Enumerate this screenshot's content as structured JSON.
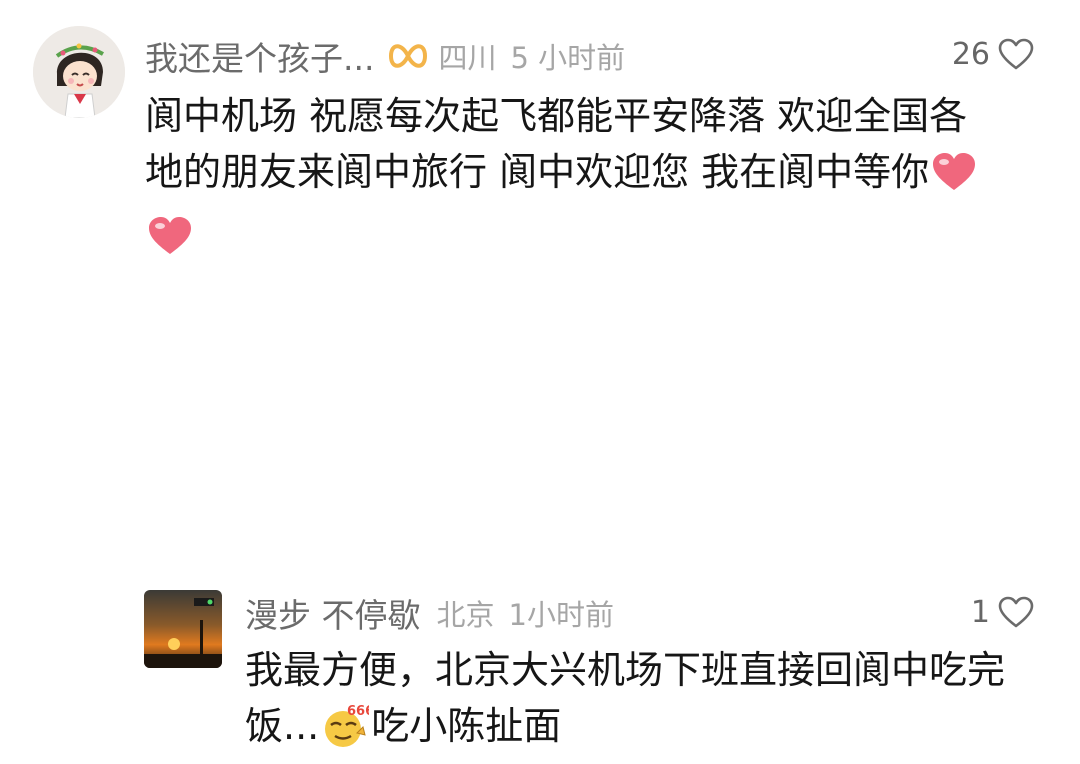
{
  "comments": [
    {
      "username": "我还是个孩子...",
      "location": "四川",
      "time": "5 小时前",
      "likes": "26",
      "text_main": "阆中机场  祝愿每次起飞都能平安降落  欢迎全国各地的朋友来阆中旅行  阆中欢迎您  我在阆中等你",
      "text_tail": "",
      "emojis": [
        "heart-emoji",
        "heart-emoji"
      ]
    },
    {
      "username": "漫步  不停歇",
      "location": "北京",
      "time": "1小时前",
      "likes": "1",
      "text_main": "我最方便，北京大兴机场下班直接回阆中吃完饭...",
      "text_tail": "吃小陈扯面",
      "emoji_label": "666"
    }
  ],
  "colors": {
    "username": "#6b6b6b",
    "meta": "#a6a6a6",
    "text": "#161616",
    "badge": "#f3b44a",
    "heart": "#f0677d"
  },
  "icons": {
    "like": "heart-outline-icon",
    "badge": "infinity-badge-icon"
  }
}
